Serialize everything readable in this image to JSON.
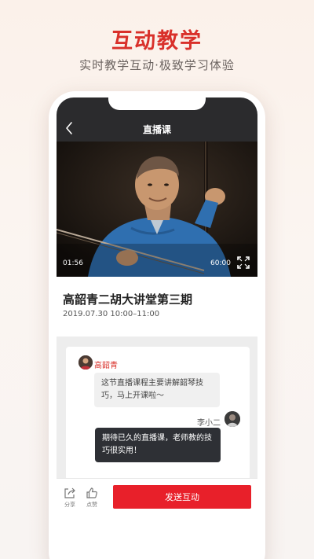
{
  "promo": {
    "title": "互动教学",
    "subtitle": "实时教学互动·极致学习体验"
  },
  "header": {
    "title": "直播课"
  },
  "video": {
    "current_time": "01:56",
    "total_time": "60:00",
    "progress": 0.09
  },
  "course": {
    "title": "高韶青二胡大讲堂第三期",
    "time": "2019.07.30 10:00–11:00"
  },
  "chat": {
    "messages": [
      {
        "sender": "高韶青",
        "text": "这节直播课程主要讲解韶琴技巧，马上开课啦～"
      },
      {
        "sender": "李小二",
        "text": "期待已久的直播课，老师教的技巧很实用！"
      }
    ]
  },
  "bottom": {
    "share_label": "分享",
    "like_label": "点赞",
    "send_label": "发送互动"
  },
  "colors": {
    "accent": "#d9302a",
    "send_button": "#e8202a",
    "header_bg": "#2b2b2d"
  },
  "icons": {
    "back": "chevron-left-icon",
    "fullscreen": "fullscreen-icon",
    "share": "share-icon",
    "like": "thumbs-up-icon"
  }
}
